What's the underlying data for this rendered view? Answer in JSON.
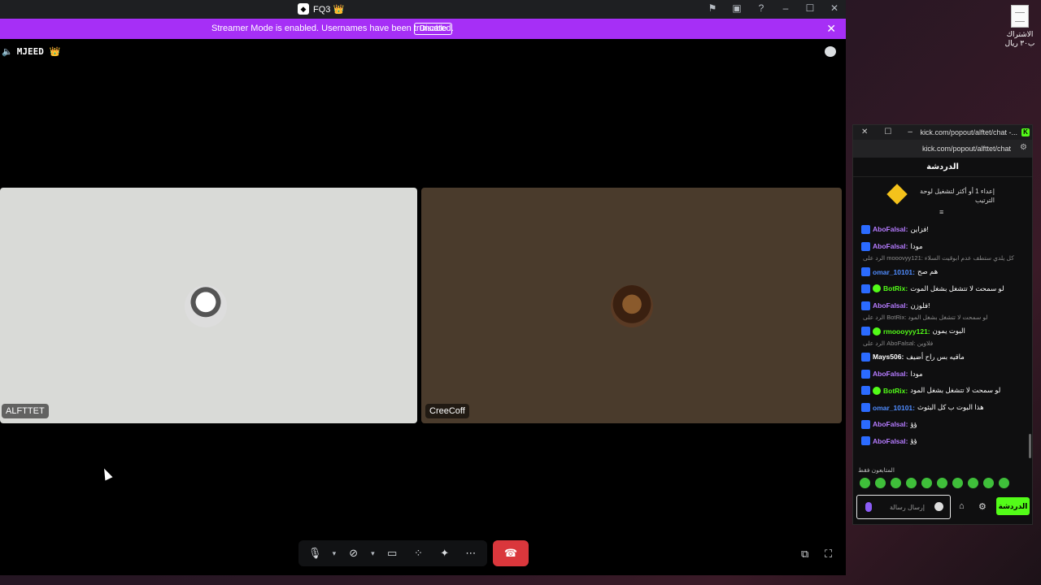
{
  "discord": {
    "title": "FQ3 👑",
    "server_icon": "server-icon",
    "banner": {
      "text": "Streamer Mode is enabled. Usernames have been truncated.",
      "disable_label": "Disable"
    },
    "channel": {
      "name": "MJEED 👑"
    },
    "tiles": [
      {
        "name": "ALFTTET"
      },
      {
        "name": "CreeCoff"
      }
    ]
  },
  "desktop": {
    "file_label": "الاشتراك ب٣٠ ريال"
  },
  "kick": {
    "window_title": "kick.com/popout/alftet/chat -...",
    "url": "kick.com/popout/alfttet/chat",
    "header": "الدردشة",
    "pinned": "إعداء 1 أو أكثر لتشغيل لوحة الترتيب",
    "top_fragment": "...",
    "messages": [
      {
        "user": "AboFalsal:",
        "text": "فزاين!",
        "color": "#b57bff",
        "verified": false,
        "reply": ""
      },
      {
        "user": "AboFalsal:",
        "text": "مودا",
        "color": "#b57bff",
        "verified": false,
        "reply": ""
      },
      {
        "user": "omar_10101:",
        "text": "هم صح",
        "color": "#4f8cff",
        "verified": false,
        "reply": "الرد على mooovyy121: كل يلدي ستطف عدم ابوقيت السلاء"
      },
      {
        "user": "BotRix:",
        "text": "لو سمحت لا تتشغل بشغل الموت",
        "color": "#53fc18",
        "verified": true,
        "reply": ""
      },
      {
        "user": "AboFalsal:",
        "text": "فلوزن!",
        "color": "#b57bff",
        "verified": false,
        "reply": ""
      },
      {
        "user": "rmoooyyy121:",
        "text": "البوت يمون",
        "color": "#53fc18",
        "verified": true,
        "reply": "الرد على BotRix: لو سمحت لا تتشغل بشغل المود"
      },
      {
        "user": "Mays506:",
        "text": "ماقيه بس راح أضيف",
        "color": "#ffffff",
        "verified": false,
        "reply": "الرد على AboFalsal: فلاوين"
      },
      {
        "user": "AboFalsal:",
        "text": "مودا",
        "color": "#b57bff",
        "verified": false,
        "reply": ""
      },
      {
        "user": "BotRix:",
        "text": "لو سمحت لا تتشغل بشغل المود",
        "color": "#53fc18",
        "verified": true,
        "reply": ""
      },
      {
        "user": "omar_10101:",
        "text": "هذا البوت ب كل البثوث",
        "color": "#4f8cff",
        "verified": false,
        "reply": ""
      },
      {
        "user": "AboFalsal:",
        "text": "ؤؤ",
        "color": "#b57bff",
        "verified": false,
        "reply": ""
      },
      {
        "user": "AboFalsal:",
        "text": "ؤؤ",
        "color": "#b57bff",
        "verified": false,
        "reply": ""
      }
    ],
    "emote_label": "المتابعون فقط",
    "input_placeholder": "إرسال رسالة",
    "send_label": "الدردشة"
  }
}
